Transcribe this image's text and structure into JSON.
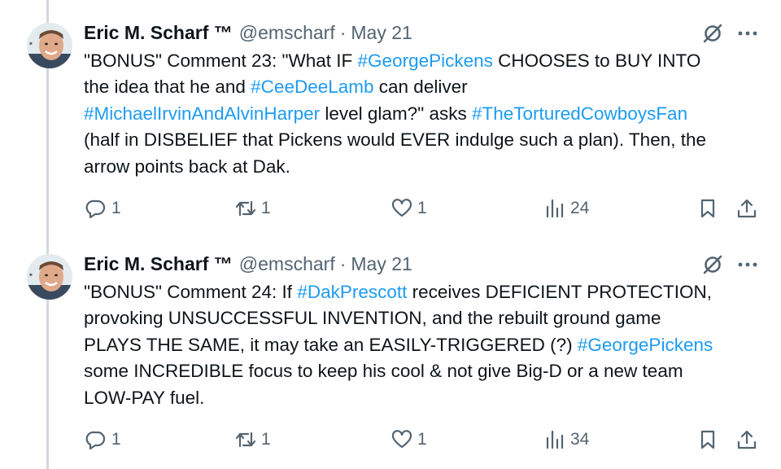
{
  "tweets": [
    {
      "author_name": "Eric M. Scharf ™",
      "handle": "@emscharf",
      "separator": "·",
      "date": "May 21",
      "body": [
        {
          "text": "\"BONUS\" Comment 23: \"What IF ",
          "hashtag": false
        },
        {
          "text": "#GeorgePickens",
          "hashtag": true
        },
        {
          "text": " CHOOSES to BUY INTO\nthe idea that he and ",
          "hashtag": false
        },
        {
          "text": "#CeeDeeLamb",
          "hashtag": true
        },
        {
          "text": " can deliver\n",
          "hashtag": false
        },
        {
          "text": "#MichaelIrvinAndAlvinHarper",
          "hashtag": true
        },
        {
          "text": " level glam?\" asks ",
          "hashtag": false
        },
        {
          "text": "#TheTorturedCowboysFan",
          "hashtag": true
        },
        {
          "text": "\n(half in DISBELIEF that Pickens would EVER indulge such a plan). Then, the\narrow points back at Dak.",
          "hashtag": false
        }
      ],
      "stats": {
        "replies": "1",
        "retweets": "1",
        "likes": "1",
        "views": "24"
      }
    },
    {
      "author_name": "Eric M. Scharf ™",
      "handle": "@emscharf",
      "separator": "·",
      "date": "May 21",
      "body": [
        {
          "text": "\"BONUS\" Comment 24: If ",
          "hashtag": false
        },
        {
          "text": "#DakPrescott",
          "hashtag": true
        },
        {
          "text": " receives DEFICIENT PROTECTION,\nprovoking UNSUCCESSFUL INVENTION, and the rebuilt ground game\nPLAYS THE SAME, it may take an EASILY-TRIGGERED (?) ",
          "hashtag": false
        },
        {
          "text": "#GeorgePickens",
          "hashtag": true
        },
        {
          "text": "\nsome INCREDIBLE focus to keep his cool & not give Big-D or a new team\nLOW-PAY fuel.",
          "hashtag": false
        }
      ],
      "stats": {
        "replies": "1",
        "retweets": "1",
        "likes": "1",
        "views": "34"
      }
    }
  ],
  "icons": {
    "grok": "grok-slash-circle-icon",
    "more": "more-dots-icon",
    "reply": "reply-bubble-icon",
    "retweet": "retweet-icon",
    "like": "heart-icon",
    "views": "views-bars-icon",
    "bookmark": "bookmark-icon",
    "share": "share-upload-icon"
  },
  "colors": {
    "text": "#0f1419",
    "secondary": "#536471",
    "hashtag": "#1d9bf0",
    "thread_line": "#cfd9de"
  }
}
